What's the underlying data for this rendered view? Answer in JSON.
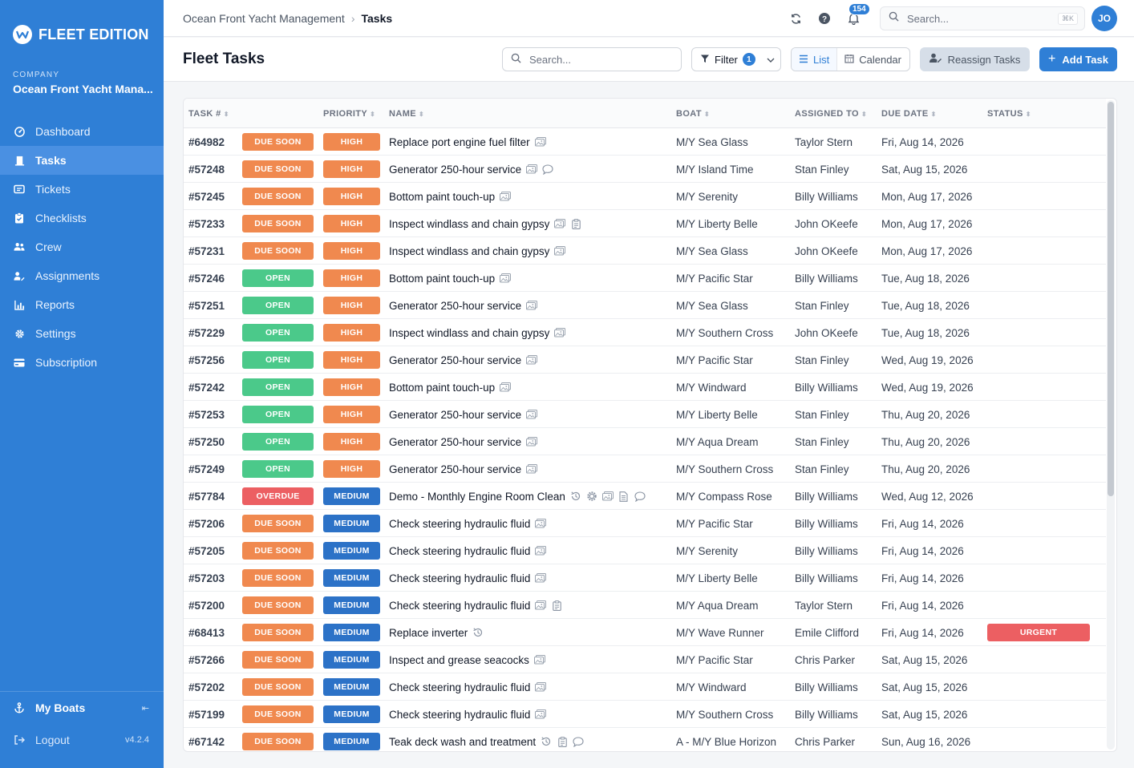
{
  "brand": {
    "name": "FLEET EDITION"
  },
  "company": {
    "label": "COMPANY",
    "name": "Ocean Front Yacht Mana..."
  },
  "nav": [
    {
      "label": "Dashboard",
      "icon": "dashboard-icon",
      "active": false
    },
    {
      "label": "Tasks",
      "icon": "tasks-icon",
      "active": true
    },
    {
      "label": "Tickets",
      "icon": "ticket-icon",
      "active": false
    },
    {
      "label": "Checklists",
      "icon": "checklist-icon",
      "active": false
    },
    {
      "label": "Crew",
      "icon": "crew-icon",
      "active": false
    },
    {
      "label": "Assignments",
      "icon": "assignments-icon",
      "active": false
    },
    {
      "label": "Reports",
      "icon": "reports-icon",
      "active": false
    },
    {
      "label": "Settings",
      "icon": "gear-icon",
      "active": false
    },
    {
      "label": "Subscription",
      "icon": "credit-card-icon",
      "active": false
    }
  ],
  "sidebar_bottom": {
    "my_boats": "My Boats",
    "logout": "Logout",
    "version": "v4.2.4"
  },
  "topbar": {
    "breadcrumb_parent": "Ocean Front Yacht Management",
    "breadcrumb_current": "Tasks",
    "notification_count": "154",
    "search_placeholder": "Search...",
    "search_shortcut": "⌘K",
    "avatar_initials": "JO"
  },
  "page": {
    "title": "Fleet Tasks",
    "search_placeholder": "Search...",
    "filter_label": "Filter",
    "filter_count": "1",
    "view_list": "List",
    "view_calendar": "Calendar",
    "reassign_label": "Reassign Tasks",
    "add_label": "Add Task"
  },
  "colors": {
    "due_soon": "#f0894f",
    "open": "#4bc98a",
    "overdue": "#ec5f62",
    "high": "#f0894f",
    "medium": "#2c72c7",
    "urgent": "#ec5f62",
    "accent": "#2f7fd6"
  },
  "table": {
    "headers": {
      "task": "TASK #",
      "priority": "PRIORITY",
      "name": "NAME",
      "boat": "BOAT",
      "assigned": "ASSIGNED TO",
      "due": "DUE DATE",
      "status": "STATUS"
    },
    "rows": [
      {
        "id": "#64982",
        "state": "DUE SOON",
        "priority": "HIGH",
        "name": "Replace port engine fuel filter",
        "icons": [
          "image-icon"
        ],
        "boat": "M/Y Sea Glass",
        "assigned": "Taylor Stern",
        "due": "Fri, Aug 14, 2026",
        "status": ""
      },
      {
        "id": "#57248",
        "state": "DUE SOON",
        "priority": "HIGH",
        "name": "Generator 250-hour service",
        "icons": [
          "image-icon",
          "comment-icon"
        ],
        "boat": "M/Y Island Time",
        "assigned": "Stan Finley",
        "due": "Sat, Aug 15, 2026",
        "status": ""
      },
      {
        "id": "#57245",
        "state": "DUE SOON",
        "priority": "HIGH",
        "name": "Bottom paint touch-up",
        "icons": [
          "image-icon"
        ],
        "boat": "M/Y Serenity",
        "assigned": "Billy Williams",
        "due": "Mon, Aug 17, 2026",
        "status": ""
      },
      {
        "id": "#57233",
        "state": "DUE SOON",
        "priority": "HIGH",
        "name": "Inspect windlass and chain gypsy",
        "icons": [
          "image-icon",
          "clipboard-icon"
        ],
        "boat": "M/Y Liberty Belle",
        "assigned": "John OKeefe",
        "due": "Mon, Aug 17, 2026",
        "status": ""
      },
      {
        "id": "#57231",
        "state": "DUE SOON",
        "priority": "HIGH",
        "name": "Inspect windlass and chain gypsy",
        "icons": [
          "image-icon"
        ],
        "boat": "M/Y Sea Glass",
        "assigned": "John OKeefe",
        "due": "Mon, Aug 17, 2026",
        "status": ""
      },
      {
        "id": "#57246",
        "state": "OPEN",
        "priority": "HIGH",
        "name": "Bottom paint touch-up",
        "icons": [
          "image-icon"
        ],
        "boat": "M/Y Pacific Star",
        "assigned": "Billy Williams",
        "due": "Tue, Aug 18, 2026",
        "status": ""
      },
      {
        "id": "#57251",
        "state": "OPEN",
        "priority": "HIGH",
        "name": "Generator 250-hour service",
        "icons": [
          "image-icon"
        ],
        "boat": "M/Y Sea Glass",
        "assigned": "Stan Finley",
        "due": "Tue, Aug 18, 2026",
        "status": ""
      },
      {
        "id": "#57229",
        "state": "OPEN",
        "priority": "HIGH",
        "name": "Inspect windlass and chain gypsy",
        "icons": [
          "image-icon"
        ],
        "boat": "M/Y Southern Cross",
        "assigned": "John OKeefe",
        "due": "Tue, Aug 18, 2026",
        "status": ""
      },
      {
        "id": "#57256",
        "state": "OPEN",
        "priority": "HIGH",
        "name": "Generator 250-hour service",
        "icons": [
          "image-icon"
        ],
        "boat": "M/Y Pacific Star",
        "assigned": "Stan Finley",
        "due": "Wed, Aug 19, 2026",
        "status": ""
      },
      {
        "id": "#57242",
        "state": "OPEN",
        "priority": "HIGH",
        "name": "Bottom paint touch-up",
        "icons": [
          "image-icon"
        ],
        "boat": "M/Y Windward",
        "assigned": "Billy Williams",
        "due": "Wed, Aug 19, 2026",
        "status": ""
      },
      {
        "id": "#57253",
        "state": "OPEN",
        "priority": "HIGH",
        "name": "Generator 250-hour service",
        "icons": [
          "image-icon"
        ],
        "boat": "M/Y Liberty Belle",
        "assigned": "Stan Finley",
        "due": "Thu, Aug 20, 2026",
        "status": ""
      },
      {
        "id": "#57250",
        "state": "OPEN",
        "priority": "HIGH",
        "name": "Generator 250-hour service",
        "icons": [
          "image-icon"
        ],
        "boat": "M/Y Aqua Dream",
        "assigned": "Stan Finley",
        "due": "Thu, Aug 20, 2026",
        "status": ""
      },
      {
        "id": "#57249",
        "state": "OPEN",
        "priority": "HIGH",
        "name": "Generator 250-hour service",
        "icons": [
          "image-icon"
        ],
        "boat": "M/Y Southern Cross",
        "assigned": "Stan Finley",
        "due": "Thu, Aug 20, 2026",
        "status": ""
      },
      {
        "id": "#57784",
        "state": "OVERDUE",
        "priority": "MEDIUM",
        "name": "Demo - Monthly Engine Room Clean",
        "icons": [
          "recurring-icon",
          "gear-icon",
          "image-icon",
          "document-icon",
          "comment-icon"
        ],
        "boat": "M/Y Compass Rose",
        "assigned": "Billy Williams",
        "due": "Wed, Aug 12, 2026",
        "status": ""
      },
      {
        "id": "#57206",
        "state": "DUE SOON",
        "priority": "MEDIUM",
        "name": "Check steering hydraulic fluid",
        "icons": [
          "image-icon"
        ],
        "boat": "M/Y Pacific Star",
        "assigned": "Billy Williams",
        "due": "Fri, Aug 14, 2026",
        "status": ""
      },
      {
        "id": "#57205",
        "state": "DUE SOON",
        "priority": "MEDIUM",
        "name": "Check steering hydraulic fluid",
        "icons": [
          "image-icon"
        ],
        "boat": "M/Y Serenity",
        "assigned": "Billy Williams",
        "due": "Fri, Aug 14, 2026",
        "status": ""
      },
      {
        "id": "#57203",
        "state": "DUE SOON",
        "priority": "MEDIUM",
        "name": "Check steering hydraulic fluid",
        "icons": [
          "image-icon"
        ],
        "boat": "M/Y Liberty Belle",
        "assigned": "Billy Williams",
        "due": "Fri, Aug 14, 2026",
        "status": ""
      },
      {
        "id": "#57200",
        "state": "DUE SOON",
        "priority": "MEDIUM",
        "name": "Check steering hydraulic fluid",
        "icons": [
          "image-icon",
          "clipboard-icon"
        ],
        "boat": "M/Y Aqua Dream",
        "assigned": "Taylor Stern",
        "due": "Fri, Aug 14, 2026",
        "status": ""
      },
      {
        "id": "#68413",
        "state": "DUE SOON",
        "priority": "MEDIUM",
        "name": "Replace inverter",
        "icons": [
          "recurring-icon"
        ],
        "boat": "M/Y Wave Runner",
        "assigned": "Emile Clifford",
        "due": "Fri, Aug 14, 2026",
        "status": "URGENT"
      },
      {
        "id": "#57266",
        "state": "DUE SOON",
        "priority": "MEDIUM",
        "name": "Inspect and grease seacocks",
        "icons": [
          "image-icon"
        ],
        "boat": "M/Y Pacific Star",
        "assigned": "Chris Parker",
        "due": "Sat, Aug 15, 2026",
        "status": ""
      },
      {
        "id": "#57202",
        "state": "DUE SOON",
        "priority": "MEDIUM",
        "name": "Check steering hydraulic fluid",
        "icons": [
          "image-icon"
        ],
        "boat": "M/Y Windward",
        "assigned": "Billy Williams",
        "due": "Sat, Aug 15, 2026",
        "status": ""
      },
      {
        "id": "#57199",
        "state": "DUE SOON",
        "priority": "MEDIUM",
        "name": "Check steering hydraulic fluid",
        "icons": [
          "image-icon"
        ],
        "boat": "M/Y Southern Cross",
        "assigned": "Billy Williams",
        "due": "Sat, Aug 15, 2026",
        "status": ""
      },
      {
        "id": "#67142",
        "state": "DUE SOON",
        "priority": "MEDIUM",
        "name": "Teak deck wash and treatment",
        "icons": [
          "recurring-icon",
          "clipboard-icon",
          "comment-icon"
        ],
        "boat": "A - M/Y Blue Horizon",
        "assigned": "Chris Parker",
        "due": "Sun, Aug 16, 2026",
        "status": ""
      }
    ]
  }
}
